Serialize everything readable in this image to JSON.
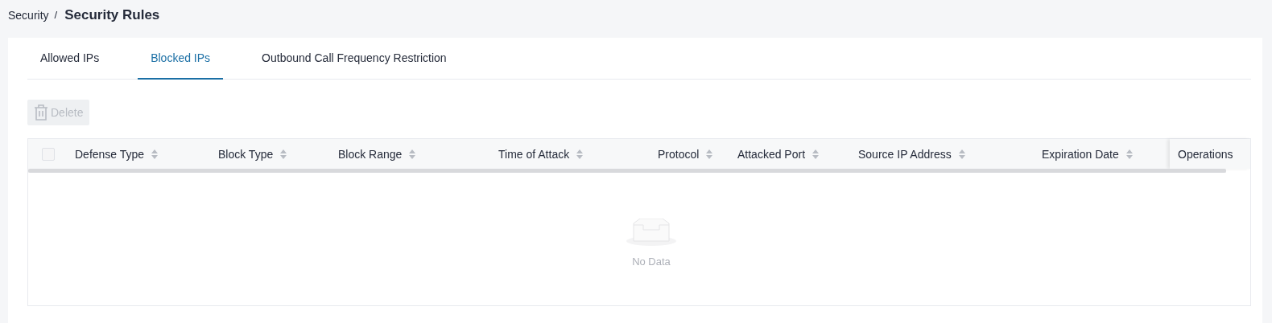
{
  "breadcrumb": {
    "parent": "Security",
    "separator": "/",
    "current": "Security Rules"
  },
  "tabs": [
    {
      "label": "Allowed IPs",
      "selected": false
    },
    {
      "label": "Blocked IPs",
      "selected": true
    },
    {
      "label": "Outbound Call Frequency Restriction",
      "selected": false
    }
  ],
  "toolbar": {
    "delete_button": {
      "label": "Delete",
      "disabled": true
    }
  },
  "table": {
    "select_all": {
      "checked": false
    },
    "columns": [
      {
        "label": "Defense Type",
        "sortable": true
      },
      {
        "label": "Block Type",
        "sortable": true
      },
      {
        "label": "Block Range",
        "sortable": true
      },
      {
        "label": "Time of Attack",
        "sortable": true
      },
      {
        "label": "Protocol",
        "sortable": true
      },
      {
        "label": "Attacked Port",
        "sortable": true
      },
      {
        "label": "Source IP Address",
        "sortable": true
      },
      {
        "label": "Expiration Date",
        "sortable": true
      },
      {
        "label": "Operations",
        "sortable": false
      }
    ],
    "empty_text": "No Data"
  }
}
